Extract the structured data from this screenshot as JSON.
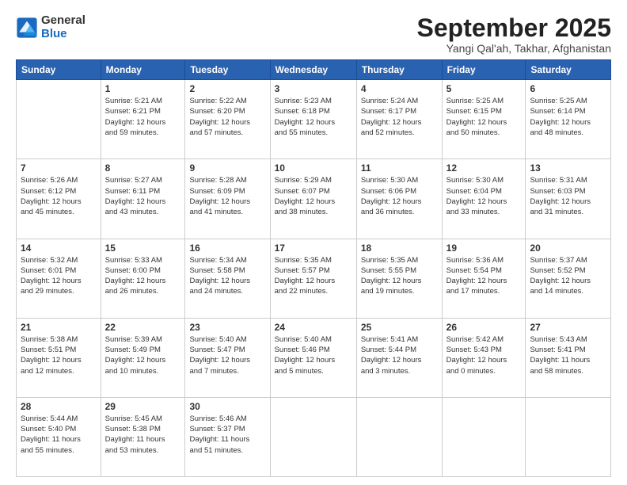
{
  "logo": {
    "general": "General",
    "blue": "Blue"
  },
  "title": "September 2025",
  "subtitle": "Yangi Qal'ah, Takhar, Afghanistan",
  "headers": [
    "Sunday",
    "Monday",
    "Tuesday",
    "Wednesday",
    "Thursday",
    "Friday",
    "Saturday"
  ],
  "weeks": [
    [
      {
        "day": "",
        "info": ""
      },
      {
        "day": "1",
        "info": "Sunrise: 5:21 AM\nSunset: 6:21 PM\nDaylight: 12 hours\nand 59 minutes."
      },
      {
        "day": "2",
        "info": "Sunrise: 5:22 AM\nSunset: 6:20 PM\nDaylight: 12 hours\nand 57 minutes."
      },
      {
        "day": "3",
        "info": "Sunrise: 5:23 AM\nSunset: 6:18 PM\nDaylight: 12 hours\nand 55 minutes."
      },
      {
        "day": "4",
        "info": "Sunrise: 5:24 AM\nSunset: 6:17 PM\nDaylight: 12 hours\nand 52 minutes."
      },
      {
        "day": "5",
        "info": "Sunrise: 5:25 AM\nSunset: 6:15 PM\nDaylight: 12 hours\nand 50 minutes."
      },
      {
        "day": "6",
        "info": "Sunrise: 5:25 AM\nSunset: 6:14 PM\nDaylight: 12 hours\nand 48 minutes."
      }
    ],
    [
      {
        "day": "7",
        "info": "Sunrise: 5:26 AM\nSunset: 6:12 PM\nDaylight: 12 hours\nand 45 minutes."
      },
      {
        "day": "8",
        "info": "Sunrise: 5:27 AM\nSunset: 6:11 PM\nDaylight: 12 hours\nand 43 minutes."
      },
      {
        "day": "9",
        "info": "Sunrise: 5:28 AM\nSunset: 6:09 PM\nDaylight: 12 hours\nand 41 minutes."
      },
      {
        "day": "10",
        "info": "Sunrise: 5:29 AM\nSunset: 6:07 PM\nDaylight: 12 hours\nand 38 minutes."
      },
      {
        "day": "11",
        "info": "Sunrise: 5:30 AM\nSunset: 6:06 PM\nDaylight: 12 hours\nand 36 minutes."
      },
      {
        "day": "12",
        "info": "Sunrise: 5:30 AM\nSunset: 6:04 PM\nDaylight: 12 hours\nand 33 minutes."
      },
      {
        "day": "13",
        "info": "Sunrise: 5:31 AM\nSunset: 6:03 PM\nDaylight: 12 hours\nand 31 minutes."
      }
    ],
    [
      {
        "day": "14",
        "info": "Sunrise: 5:32 AM\nSunset: 6:01 PM\nDaylight: 12 hours\nand 29 minutes."
      },
      {
        "day": "15",
        "info": "Sunrise: 5:33 AM\nSunset: 6:00 PM\nDaylight: 12 hours\nand 26 minutes."
      },
      {
        "day": "16",
        "info": "Sunrise: 5:34 AM\nSunset: 5:58 PM\nDaylight: 12 hours\nand 24 minutes."
      },
      {
        "day": "17",
        "info": "Sunrise: 5:35 AM\nSunset: 5:57 PM\nDaylight: 12 hours\nand 22 minutes."
      },
      {
        "day": "18",
        "info": "Sunrise: 5:35 AM\nSunset: 5:55 PM\nDaylight: 12 hours\nand 19 minutes."
      },
      {
        "day": "19",
        "info": "Sunrise: 5:36 AM\nSunset: 5:54 PM\nDaylight: 12 hours\nand 17 minutes."
      },
      {
        "day": "20",
        "info": "Sunrise: 5:37 AM\nSunset: 5:52 PM\nDaylight: 12 hours\nand 14 minutes."
      }
    ],
    [
      {
        "day": "21",
        "info": "Sunrise: 5:38 AM\nSunset: 5:51 PM\nDaylight: 12 hours\nand 12 minutes."
      },
      {
        "day": "22",
        "info": "Sunrise: 5:39 AM\nSunset: 5:49 PM\nDaylight: 12 hours\nand 10 minutes."
      },
      {
        "day": "23",
        "info": "Sunrise: 5:40 AM\nSunset: 5:47 PM\nDaylight: 12 hours\nand 7 minutes."
      },
      {
        "day": "24",
        "info": "Sunrise: 5:40 AM\nSunset: 5:46 PM\nDaylight: 12 hours\nand 5 minutes."
      },
      {
        "day": "25",
        "info": "Sunrise: 5:41 AM\nSunset: 5:44 PM\nDaylight: 12 hours\nand 3 minutes."
      },
      {
        "day": "26",
        "info": "Sunrise: 5:42 AM\nSunset: 5:43 PM\nDaylight: 12 hours\nand 0 minutes."
      },
      {
        "day": "27",
        "info": "Sunrise: 5:43 AM\nSunset: 5:41 PM\nDaylight: 11 hours\nand 58 minutes."
      }
    ],
    [
      {
        "day": "28",
        "info": "Sunrise: 5:44 AM\nSunset: 5:40 PM\nDaylight: 11 hours\nand 55 minutes."
      },
      {
        "day": "29",
        "info": "Sunrise: 5:45 AM\nSunset: 5:38 PM\nDaylight: 11 hours\nand 53 minutes."
      },
      {
        "day": "30",
        "info": "Sunrise: 5:46 AM\nSunset: 5:37 PM\nDaylight: 11 hours\nand 51 minutes."
      },
      {
        "day": "",
        "info": ""
      },
      {
        "day": "",
        "info": ""
      },
      {
        "day": "",
        "info": ""
      },
      {
        "day": "",
        "info": ""
      }
    ]
  ]
}
